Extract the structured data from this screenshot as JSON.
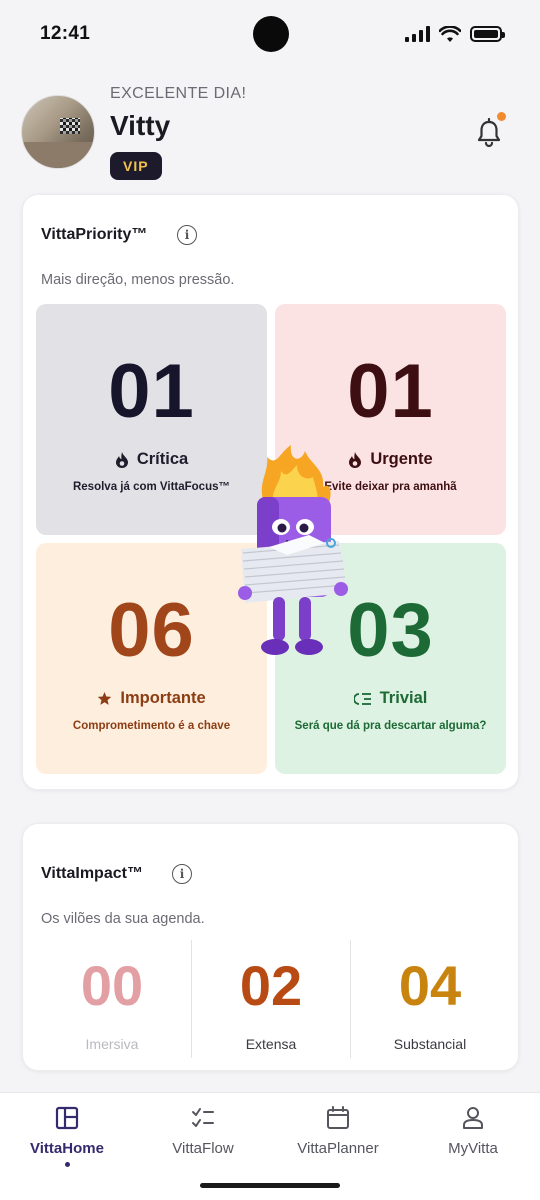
{
  "status_bar": {
    "time": "12:41"
  },
  "header": {
    "greeting": "EXCELENTE DIA!",
    "user_name": "Vitty",
    "badge": "VIP",
    "notification_dot_color": "#f28a2e"
  },
  "priority": {
    "title": "VittaPriority™",
    "subtitle": "Mais direção, menos pressão.",
    "quadrants": [
      {
        "count": "01",
        "label": "Crítica",
        "icon": "fire-icon",
        "description": "Resolva já com VittaFocus™",
        "color": "#17152b",
        "background": "#e1e1e6"
      },
      {
        "count": "01",
        "label": "Urgente",
        "icon": "fire-icon",
        "description": "Evite deixar pra amanhã",
        "color": "#3e0f12",
        "background": "#fbe3e3"
      },
      {
        "count": "06",
        "label": "Importante",
        "icon": "star-icon",
        "description": "Comprometimento é a chave",
        "color": "#a0461a",
        "background": "#fdeedd"
      },
      {
        "count": "03",
        "label": "Trivial",
        "icon": "list-icon",
        "description": "Será que dá pra descartar alguma?",
        "color": "#1d6a36",
        "background": "#ddf2e2"
      }
    ]
  },
  "impact": {
    "title": "VittaImpact™",
    "subtitle": "Os vilões da sua agenda.",
    "items": [
      {
        "count": "00",
        "label": "Imersiva",
        "color": "#e3a0a4"
      },
      {
        "count": "02",
        "label": "Extensa",
        "color": "#b84a14"
      },
      {
        "count": "04",
        "label": "Substancial",
        "color": "#c98410"
      }
    ]
  },
  "nav": {
    "items": [
      {
        "label": "VittaHome",
        "icon": "dashboard-icon",
        "active": true
      },
      {
        "label": "VittaFlow",
        "icon": "checklist-icon",
        "active": false
      },
      {
        "label": "VittaPlanner",
        "icon": "calendar-icon",
        "active": false
      },
      {
        "label": "MyVitta",
        "icon": "user-icon",
        "active": false
      }
    ]
  }
}
